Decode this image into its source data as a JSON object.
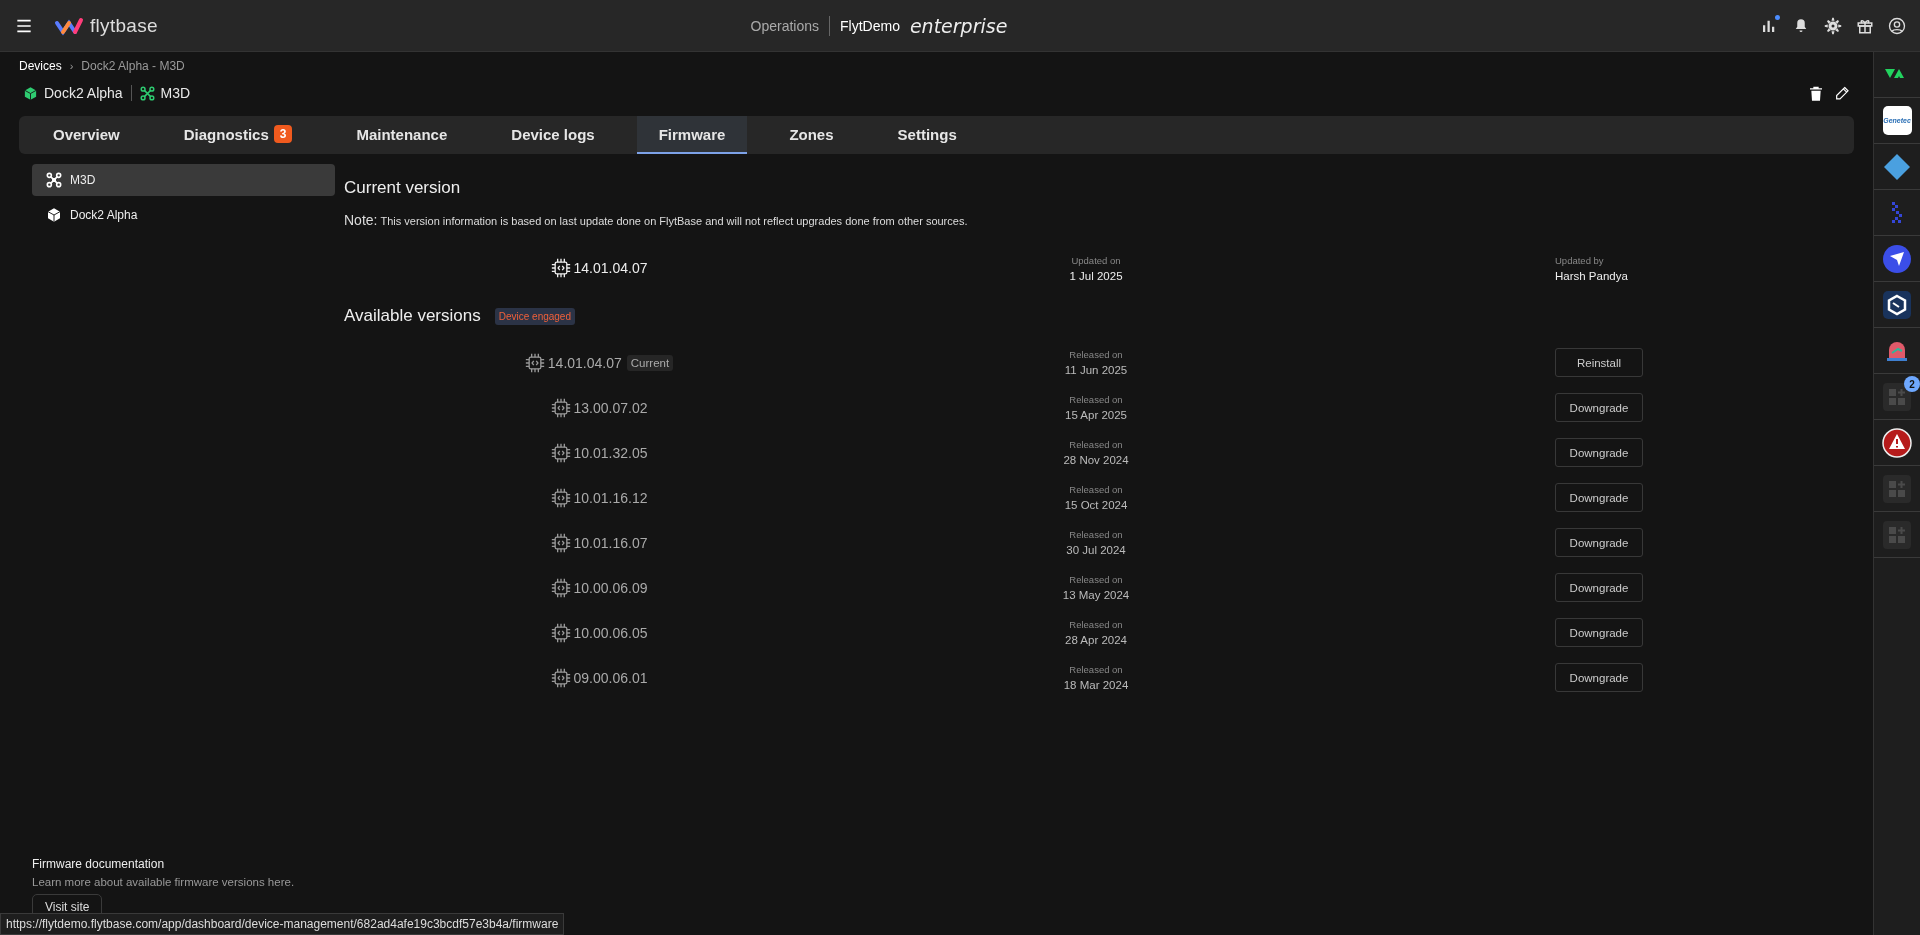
{
  "topbar": {
    "brand": "flytbase",
    "section": "Operations",
    "org": "FlytDemo",
    "edition": "enterprise",
    "icons": [
      {
        "kind": "chart",
        "dot": true
      },
      {
        "kind": "bell",
        "dot": false
      },
      {
        "kind": "gear",
        "dot": false
      },
      {
        "kind": "gift",
        "dot": false
      },
      {
        "kind": "user",
        "dot": false
      }
    ]
  },
  "breadcrumb": [
    {
      "label": "Devices",
      "current": false
    },
    {
      "separator": "›",
      "label": "Dock2 Alpha - M3D",
      "current": true
    }
  ],
  "device_line": [
    {
      "kind": "dock",
      "label": "Dock2 Alpha"
    },
    {
      "kind": "drone",
      "label": "M3D"
    }
  ],
  "tabs": [
    {
      "label": "Overview",
      "selected": false
    },
    {
      "label": "Diagnostics",
      "badge": "3",
      "selected": false
    },
    {
      "label": "Maintenance",
      "selected": false
    },
    {
      "label": "Device logs",
      "selected": false
    },
    {
      "label": "Firmware",
      "selected": true
    },
    {
      "label": "Zones",
      "selected": false
    },
    {
      "label": "Settings",
      "selected": false
    }
  ],
  "sidebar": {
    "items": [
      {
        "kind": "drone",
        "label": "M3D",
        "selected": true
      },
      {
        "kind": "dock",
        "label": "Dock2 Alpha",
        "selected": false
      }
    ],
    "doc": {
      "title": "Firmware documentation",
      "text": "Learn more about available firmware versions here.",
      "button": "Visit site"
    }
  },
  "current": {
    "title": "Current version",
    "note_label": "Note:",
    "note": "This version information is based on last update done on FlytBase and will not reflect upgrades done from other sources.",
    "version": "14.01.04.07",
    "updated_label": "Updated on",
    "updated": "1 Jul 2025",
    "by_label": "Updated by",
    "by": "Harsh Pandya"
  },
  "available": {
    "title": "Available versions",
    "status": "Device engaged",
    "versions": [
      {
        "version": "14.01.04.07",
        "tag": "Current",
        "released_label": "Released on",
        "released": "11 Jun 2025",
        "action": "Reinstall"
      },
      {
        "version": "13.00.07.02",
        "released_label": "Released on",
        "released": "15 Apr 2025",
        "action": "Downgrade"
      },
      {
        "version": "10.01.32.05",
        "released_label": "Released on",
        "released": "28 Nov 2024",
        "action": "Downgrade"
      },
      {
        "version": "10.01.16.12",
        "released_label": "Released on",
        "released": "15 Oct 2024",
        "action": "Downgrade"
      },
      {
        "version": "10.01.16.07",
        "released_label": "Released on",
        "released": "30 Jul 2024",
        "action": "Downgrade"
      },
      {
        "version": "10.00.06.09",
        "released_label": "Released on",
        "released": "13 May 2024",
        "action": "Downgrade"
      },
      {
        "version": "10.00.06.05",
        "released_label": "Released on",
        "released": "28 Apr 2024",
        "action": "Downgrade"
      },
      {
        "version": "09.00.06.01",
        "released_label": "Released on",
        "released": "18 Mar 2024",
        "action": "Downgrade"
      }
    ]
  },
  "rail": [
    {
      "kind": "va"
    },
    {
      "kind": "genetec",
      "label": "Genetec"
    },
    {
      "kind": "diamond"
    },
    {
      "kind": "dots"
    },
    {
      "kind": "send"
    },
    {
      "kind": "hex"
    },
    {
      "kind": "alarm"
    },
    {
      "kind": "addon",
      "badge": "2"
    },
    {
      "kind": "warning"
    },
    {
      "kind": "addon"
    },
    {
      "kind": "addon"
    }
  ],
  "status_url": "https://flytdemo.flytbase.com/app/dashboard/device-management/682ad4afe19c3bcdf57e3b4a/firmware"
}
